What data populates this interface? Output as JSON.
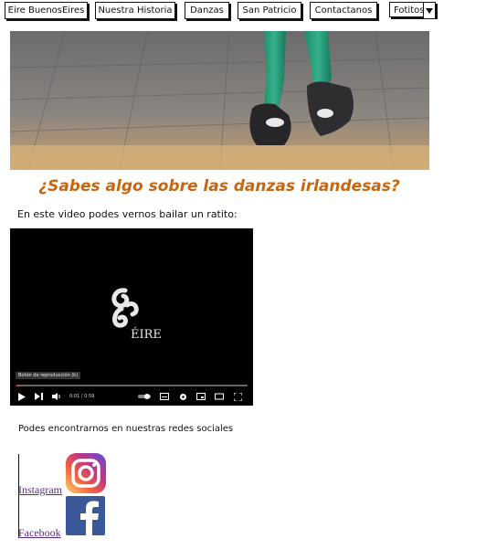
{
  "nav": {
    "items": [
      {
        "label": "Eire BuenosEires"
      },
      {
        "label": "Nuestra Historia"
      },
      {
        "label": "Danzas"
      },
      {
        "label": "San Patricio"
      },
      {
        "label": "Contactanos"
      }
    ],
    "dropdown": {
      "label": "Fotitos"
    }
  },
  "main": {
    "title": "¿Sabes algo sobre las danzas irlandesas?",
    "intro": "En este video podes vernos bailar un ratito:"
  },
  "video": {
    "logo_text": "ÉIRE",
    "tooltip": "Botón de reproducción (k)",
    "time": "0:01 / 0:59"
  },
  "social": {
    "text": "Podes encontrarnos en nuestras redes sociales",
    "instagram_label": "Instagram",
    "facebook_label": "Facebook"
  },
  "colors": {
    "title": "#c8650f",
    "link": "#5b2a8f",
    "facebook": "#3b5998"
  }
}
